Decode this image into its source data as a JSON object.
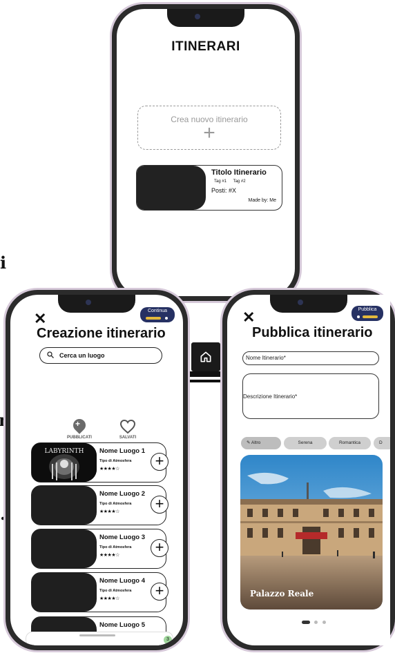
{
  "side_letters": {
    "a": "i",
    "b": "ne",
    "c": "."
  },
  "itinerari_screen": {
    "title": "ITINERARI",
    "new_itinerary": {
      "label": "Crea nuovo itinerario",
      "plus": "+"
    },
    "card": {
      "title": "Titolo Itinerario",
      "tags": [
        "Tag #1",
        "Tag #2"
      ],
      "posti": "Posti: #X",
      "made_by": "Made by: Me"
    }
  },
  "creazione_screen": {
    "close": "✕",
    "continue_label": "Continua",
    "title": "Creazione itinerario",
    "search_placeholder": "Cerca un luogo",
    "segments": {
      "published": "PUBBLICATI",
      "saved": "SALVATI"
    },
    "places": [
      {
        "name": "Nome Luogo 1",
        "type": "Tipo di Atmosfera",
        "stars": "★★★★☆",
        "thumb_label": "LABYRINTH"
      },
      {
        "name": "Nome Luogo 2",
        "type": "Tipo di Atmosfera",
        "stars": "★★★★☆"
      },
      {
        "name": "Nome Luogo 3",
        "type": "Tipo di Atmosfera",
        "stars": "★★★★☆"
      },
      {
        "name": "Nome Luogo 4",
        "type": "Tipo di Atmosfera",
        "stars": "★★★★☆"
      },
      {
        "name": "Nome Luogo 5",
        "type": "",
        "stars": ""
      }
    ],
    "add_symbol": "+",
    "count": "3"
  },
  "pubblica_screen": {
    "close": "✕",
    "publish_label": "Pubblica",
    "title": "Pubblica itinerario",
    "name_field": "Nome Itinerario*",
    "desc_field": "Descrizione Itinerario*",
    "chips": [
      "Altro",
      "Serena",
      "Romantica",
      "D"
    ],
    "photo_caption": "Palazzo Reale"
  },
  "colors": {
    "accent_navy": "#263163",
    "accent_gold": "#e3b83c",
    "badge_green": "#9fd69b"
  }
}
